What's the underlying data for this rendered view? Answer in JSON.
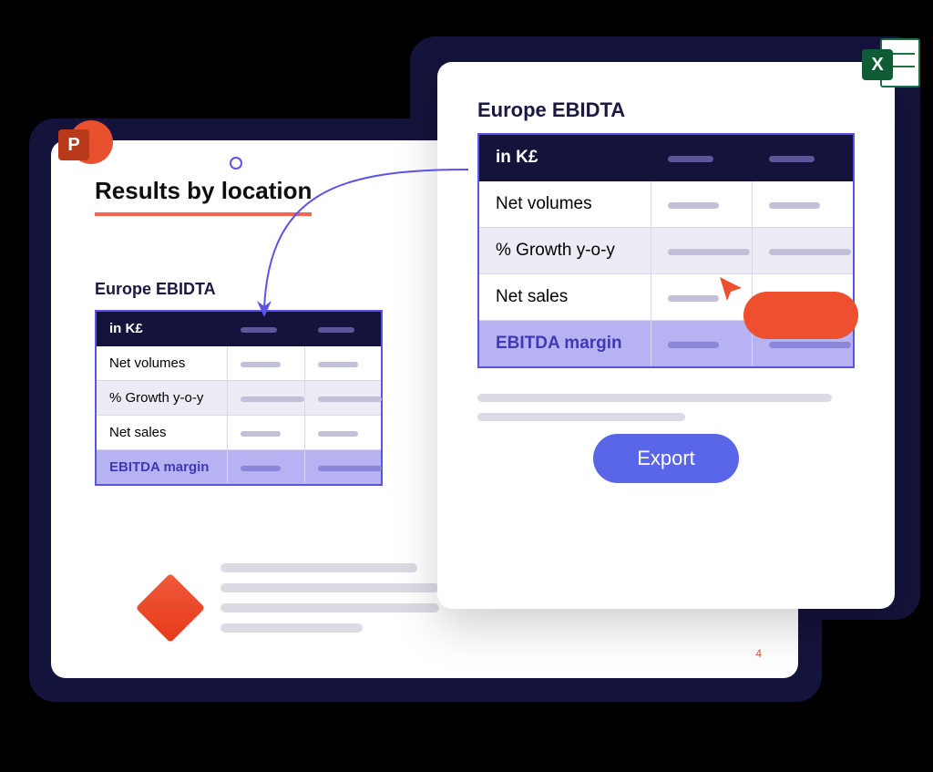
{
  "icons": {
    "powerpoint_letter": "P",
    "excel_letter": "X"
  },
  "left_panel": {
    "title": "Results by location",
    "subtitle": "Europe EBIDTA",
    "page_number": "4"
  },
  "right_panel": {
    "subtitle": "Europe EBIDTA",
    "export_label": "Export"
  },
  "table": {
    "header_label": "in K£",
    "rows": {
      "r0": "Net volumes",
      "r1": "% Growth y-o-y",
      "r2": "Net sales",
      "r3": "EBITDA margin"
    }
  }
}
